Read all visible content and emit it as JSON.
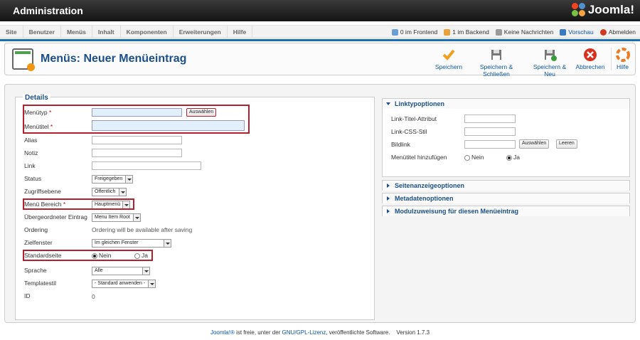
{
  "header": {
    "title": "Administration",
    "logo_text": "Joomla!"
  },
  "menu": [
    "Site",
    "Benutzer",
    "Menüs",
    "Inhalt",
    "Komponenten",
    "Erweiterungen",
    "Hilfe"
  ],
  "status": {
    "frontend": "0 im Frontend",
    "backend": "1 im Backend",
    "messages": "Keine Nachrichten",
    "preview": "Vorschau",
    "logout": "Abmelden"
  },
  "page": {
    "title": "Menüs: Neuer Menüeintrag"
  },
  "toolbar": {
    "save": "Speichern",
    "save_close": "Speichern & Schließen",
    "save_new": "Speichern & Neu",
    "cancel": "Abbrechen",
    "help": "Hilfe"
  },
  "details": {
    "legend": "Details",
    "menutype_label": "Menütyp",
    "select_btn": "Auswählen",
    "menutitle_label": "Menütitel",
    "alias_label": "Alias",
    "note_label": "Notiz",
    "link_label": "Link",
    "status_label": "Status",
    "status_value": "Freigegeben",
    "access_label": "Zugriffsebene",
    "access_value": "Öffentlich",
    "menu_label": "Menü Bereich",
    "menu_value": "Hauptmenü",
    "parent_label": "Übergeordneter Eintrag",
    "parent_value": "Menu Item Root",
    "ordering_label": "Ordering",
    "ordering_value": "Ordering will be available after saving",
    "target_label": "Zielfenster",
    "target_value": "Im gleichen Fenster",
    "home_label": "Standardseite",
    "home_no": "Nein",
    "home_yes": "Ja",
    "lang_label": "Sprache",
    "lang_value": "Alle",
    "tpl_label": "Templatestil",
    "tpl_value": "- Standard anwenden -",
    "id_label": "ID",
    "id_value": "0"
  },
  "linktype": {
    "title": "Linktypoptionen",
    "title_attr": "Link-Titel-Attribut",
    "css": "Link-CSS-Stil",
    "image": "Bildlink",
    "select": "Auswählen",
    "clear": "Leeren",
    "add_title": "Menütitel hinzufügen",
    "no": "Nein",
    "yes": "Ja"
  },
  "panels": [
    "Seitenanzeigeoptionen",
    "Metadatenoptionen",
    "Modulzuweisung für diesen Menüeintrag"
  ],
  "footer": {
    "joomla": "Joomla!®",
    "mid": " ist freie, unter der ",
    "license": "GNU/GPL-Lizenz",
    "tail": ", veröffentlichte Software.    Version 1.7.3"
  }
}
